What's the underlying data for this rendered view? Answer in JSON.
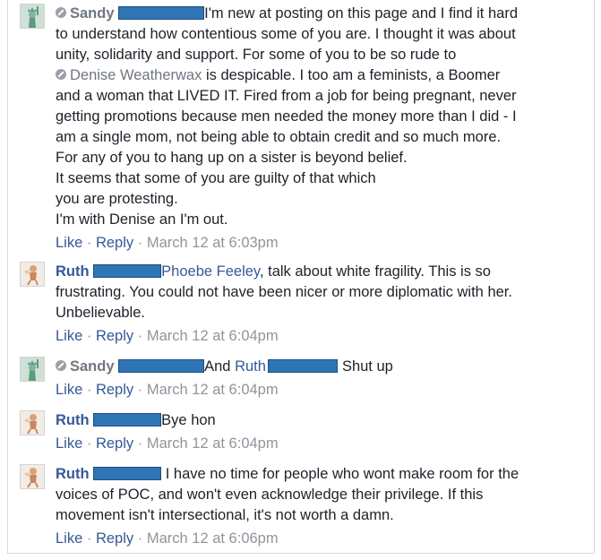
{
  "comments": [
    {
      "author": "Sandy",
      "lines": [
        "I'm new at posting on this page and I find it hard",
        "to understand how contentious some of you are. I thought it was about",
        "unity, solidarity and support. For some of you to be so rude to"
      ],
      "mention": "Denise Weatherwax",
      "line_after_mention": " is despicable. I too am a feminists, a Boomer",
      "more_lines": [
        "and a woman that LIVED IT. Fired from a job for being pregnant, never",
        "getting promotions because men needed the money more than I did -  I",
        "am a single mom, not being able to obtain credit and so much more.",
        "For any of you to hang up on a sister is beyond belief.",
        "It seems that some of you are guilty of that which",
        "you are protesting.",
        "I'm with Denise an I'm out."
      ],
      "like": "Like",
      "reply": "Reply",
      "timestamp": "March 12 at 6:03pm"
    },
    {
      "author": "Ruth",
      "mention": "Phoebe Feeley",
      "text_after_mention": ", talk about white fragility. This is so",
      "more_lines": [
        "frustrating. You could not have been nicer or more diplomatic with her.",
        "Unbelievable."
      ],
      "like": "Like",
      "reply": "Reply",
      "timestamp": "March 12 at 6:04pm"
    },
    {
      "author": "Sandy",
      "text_before_mention": "And ",
      "mention": "Ruth",
      "text_after_mention": "Shut up",
      "like": "Like",
      "reply": "Reply",
      "timestamp": "March 12 at 6:04pm"
    },
    {
      "author": "Ruth",
      "text": "Bye hon",
      "like": "Like",
      "reply": "Reply",
      "timestamp": "March 12 at 6:04pm"
    },
    {
      "author": "Ruth",
      "first_line": " I have no time for people who wont make room for the",
      "more_lines": [
        "voices of POC, and won't even acknowledge their privilege. If this",
        "movement isn't intersectional, it's not worth a damn."
      ],
      "like": "Like",
      "reply": "Reply",
      "timestamp": "March 12 at 6:06pm"
    }
  ],
  "separator": "·",
  "colors": {
    "link": "#365899",
    "meta": "#90949c",
    "redaction": "#2e75b6"
  },
  "icons": {
    "sandy_avatar": "statue-of-liberty-avatar",
    "ruth_avatar": "cherub-avatar",
    "verified": "verified-badge-icon"
  }
}
